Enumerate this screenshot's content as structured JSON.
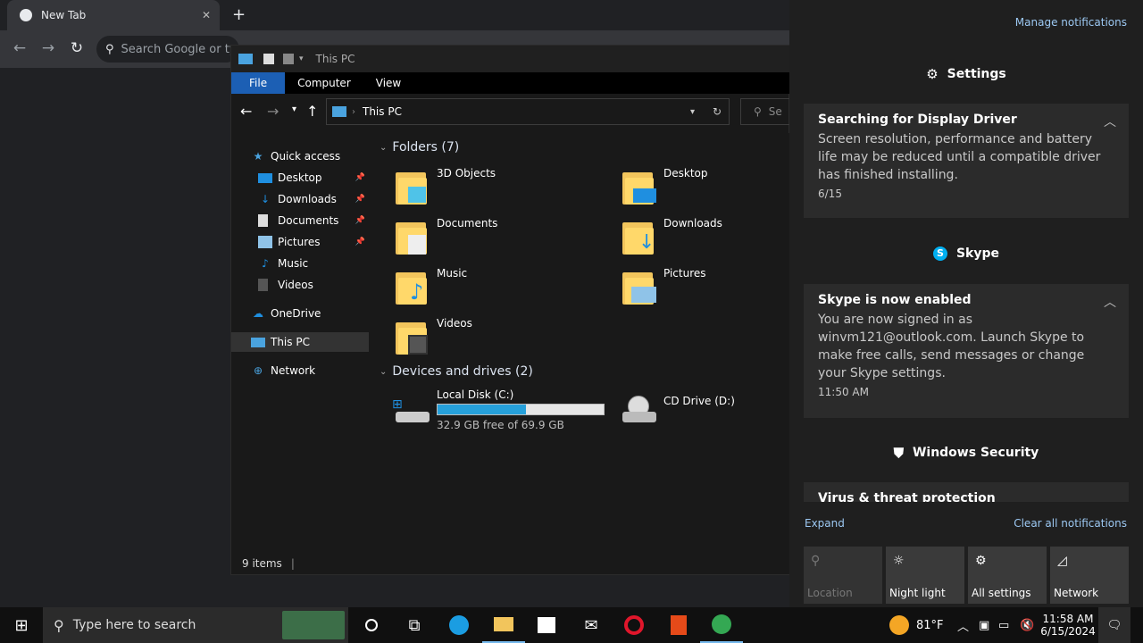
{
  "chrome": {
    "tab_title": "New Tab",
    "omnibox_placeholder": "Search Google or type a URL",
    "icons": {
      "back": "arrow-left-icon",
      "forward": "arrow-right-icon",
      "reload": "reload-icon",
      "search": "search-icon",
      "new_tab": "plus-icon",
      "close": "close-icon"
    }
  },
  "explorer": {
    "title": "This PC",
    "ribbon": [
      "File",
      "Computer",
      "View"
    ],
    "address": "This PC",
    "search_placeholder": "Se",
    "nav": [
      {
        "label": "Quick access",
        "icon": "star-icon"
      },
      {
        "label": "Desktop",
        "icon": "desktop-icon",
        "pinned": true
      },
      {
        "label": "Downloads",
        "icon": "download-icon",
        "pinned": true
      },
      {
        "label": "Documents",
        "icon": "document-icon",
        "pinned": true
      },
      {
        "label": "Pictures",
        "icon": "picture-icon",
        "pinned": true
      },
      {
        "label": "Music",
        "icon": "music-icon"
      },
      {
        "label": "Videos",
        "icon": "video-icon"
      },
      {
        "label": "OneDrive",
        "icon": "cloud-icon"
      },
      {
        "label": "This PC",
        "icon": "computer-icon",
        "selected": true
      },
      {
        "label": "Network",
        "icon": "network-icon"
      }
    ],
    "folders_header": "Folders (7)",
    "folders": [
      "3D Objects",
      "Desktop",
      "Documents",
      "Downloads",
      "Music",
      "Pictures",
      "Videos"
    ],
    "drives_header": "Devices and drives (2)",
    "drives": [
      {
        "name": "Local Disk (C:)",
        "free": "32.9 GB free of 69.9 GB",
        "used_fraction": 0.53
      },
      {
        "name": "CD Drive (D:)"
      }
    ],
    "status": "9 items"
  },
  "action_center": {
    "manage": "Manage notifications",
    "groups": [
      {
        "app": "Settings",
        "icon": "gear-icon",
        "title": "Searching for Display Driver",
        "body": "Screen resolution, performance and battery life may be reduced until a compatible driver has finished installing.",
        "time": "6/15"
      },
      {
        "app": "Skype",
        "icon": "skype-icon",
        "title": "Skype is now enabled",
        "body": "You are now signed in as winvm121@outlook.com. Launch Skype to make free calls, send messages or change your Skype settings.",
        "time": "11:50 AM"
      },
      {
        "app": "Windows Security",
        "icon": "shield-icon",
        "title": "Virus & threat protection"
      }
    ],
    "expand": "Expand",
    "clear_all": "Clear all notifications",
    "quick_actions": [
      {
        "label": "Location",
        "icon": "location-icon",
        "enabled": false
      },
      {
        "label": "Night light",
        "icon": "brightness-icon"
      },
      {
        "label": "All settings",
        "icon": "gear-icon"
      },
      {
        "label": "Network",
        "icon": "wifi-icon"
      }
    ]
  },
  "taskbar": {
    "search_placeholder": "Type here to search",
    "weather": "81°F",
    "time": "11:58 AM",
    "date": "6/15/2024"
  },
  "colors": {
    "accent": "#1c5fb4",
    "link": "#9cc8f2",
    "drive_bar": "#26a0da"
  }
}
